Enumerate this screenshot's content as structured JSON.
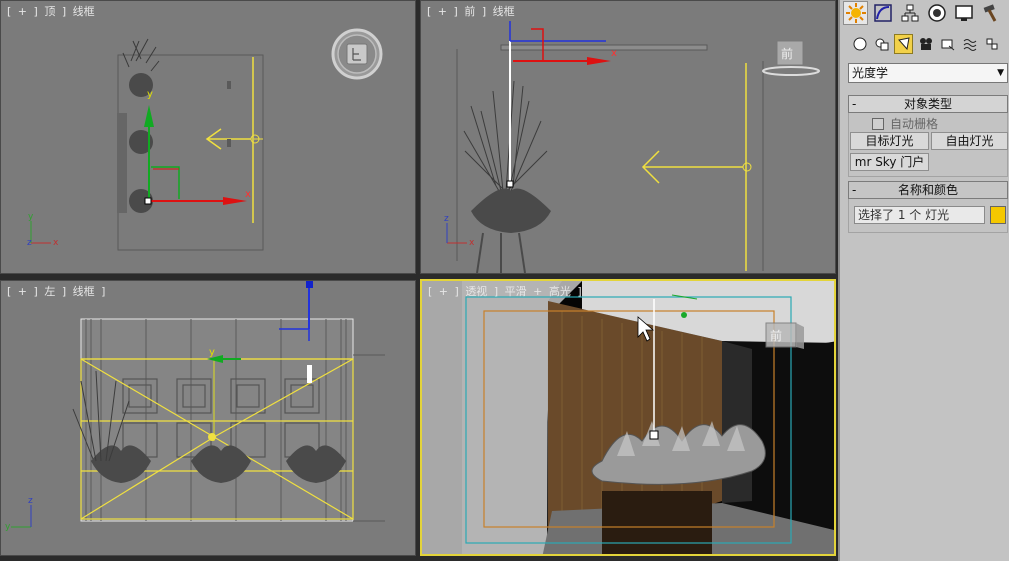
{
  "viewports": {
    "top": {
      "label": [
        "[",
        "+",
        "]",
        "顶",
        "]",
        "线框"
      ]
    },
    "front": {
      "label": [
        "[",
        "+",
        "]",
        "前",
        "]",
        "线框"
      ],
      "viewcube": "前"
    },
    "left": {
      "label": [
        "[",
        "+",
        "]",
        "左",
        "]",
        "线框",
        "]"
      ]
    },
    "perspective": {
      "label": [
        "[",
        "+",
        "]",
        "透视",
        "]",
        "平滑",
        "+",
        "高光",
        "]"
      ],
      "viewcube": "前"
    }
  },
  "command_panel": {
    "tabs": [
      "create-icon",
      "modify-icon",
      "hierarchy-icon",
      "motion-icon",
      "display-icon",
      "utilities-icon"
    ],
    "subtabs": [
      "geometry-icon",
      "shapes-icon",
      "lights-icon",
      "cameras-icon",
      "helpers-icon",
      "spacewarps-icon",
      "systems-icon"
    ],
    "category": "光度学",
    "object_type": {
      "title": "对象类型",
      "autogrid": "自动栅格",
      "buttons": [
        "目标灯光",
        "自由灯光",
        "mr Sky 门户"
      ]
    },
    "name_color": {
      "title": "名称和颜色",
      "name_value": "选择了 1 个 灯光",
      "color": "#f5c800"
    }
  },
  "axis_labels": {
    "x": "x",
    "y": "y",
    "z": "z"
  },
  "colors": {
    "active_border": "#e3d43a",
    "light_yellow": "#f0e040",
    "gizmo_red": "#dd1111",
    "gizmo_green": "#11aa22",
    "gizmo_blue": "#1122cc",
    "viewport_bg": "#7b7b7b"
  }
}
